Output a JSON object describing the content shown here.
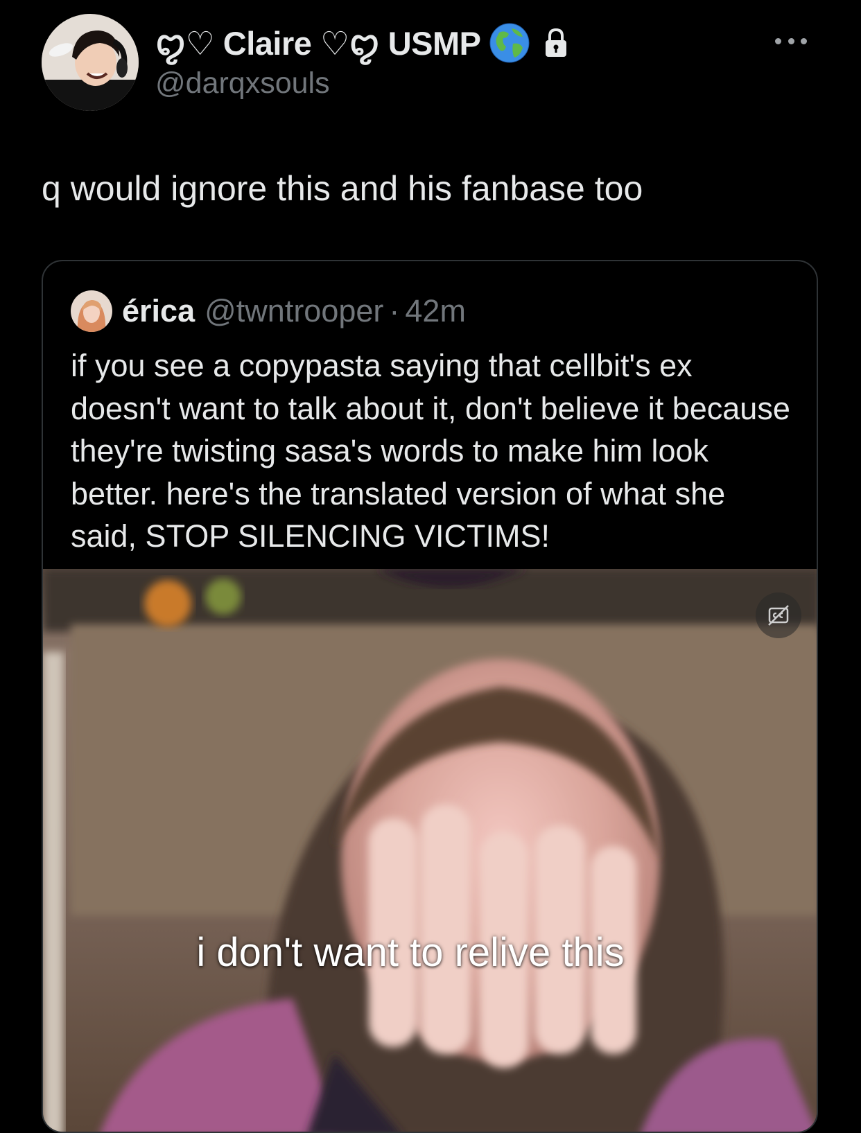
{
  "author": {
    "display_name": "ꨄ︎♡ Claire ♡ꨄ︎ USMP",
    "handle": "@darqxsouls",
    "verified_icon": "globe-icon",
    "protected_icon": "lock-icon"
  },
  "tweet": {
    "text": "q would ignore this and his fanbase too"
  },
  "quote": {
    "name": "érica",
    "handle": "@twntrooper",
    "separator": "·",
    "time": "42m",
    "text": "if you see a copypasta saying that cellbit's ex doesn't want to talk about it, don't believe it because they're twisting sasa's words to make him look better. here's the translated version of what she said, STOP SILENCING VICTIMS!",
    "media": {
      "subtitle": "i don't want to relive this",
      "caption_button_icon": "closed-captions-off-icon"
    }
  },
  "colors": {
    "background": "#000000",
    "primary_text": "#e7e9ea",
    "secondary_text": "#71767b",
    "border": "#2f3336"
  }
}
